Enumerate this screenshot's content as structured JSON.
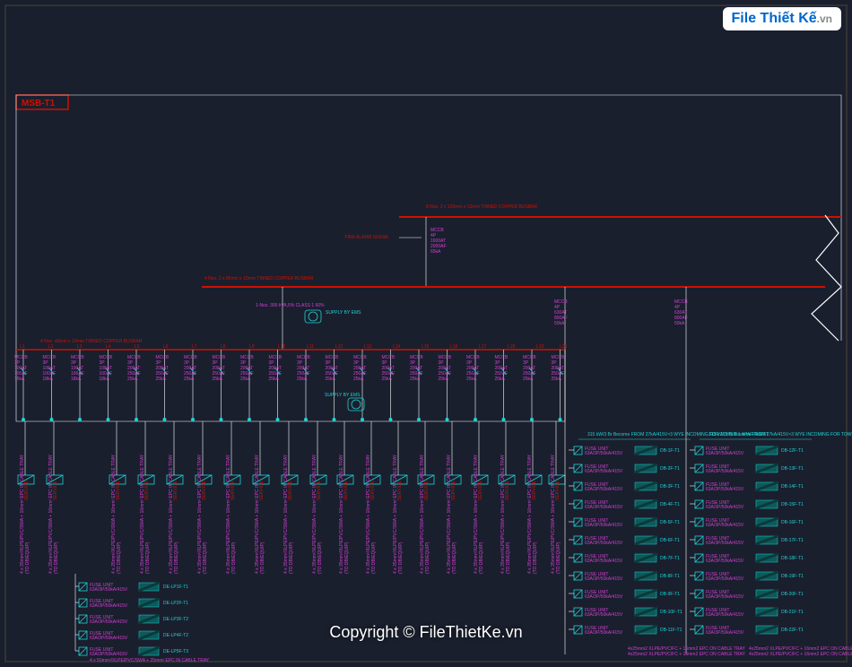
{
  "logo": {
    "brand": "File Thiết Kế",
    "suffix": ".vn"
  },
  "copyright": "Copyright © FileThietKe.vn",
  "panel": {
    "name": "MSB-T1"
  },
  "busbar_labels": {
    "top": "8 Nos. 2 x 100mm x 10mm\nTINNED COPPER BUSBAR",
    "mid": "4 Nos. 2 x 80mm x 10mm\nTINNED COPPER BUSBAR",
    "low": "4 Nos. 40mm x 10mm\nTINNED COPPER BUSBAR",
    "fire": "FIRE ALARM SIGNAL"
  },
  "device": {
    "sw": "SUPPLY BY EMS",
    "clamp": "1-Nos. 300 kVA,5%\nCLASS 1 60%"
  },
  "L_labels": [
    "L1",
    "L2",
    "L3",
    "L4",
    "L5",
    "L6",
    "L7",
    "L8",
    "L9",
    "L10",
    "L11",
    "L12",
    "L13",
    "L14",
    "L15",
    "L16",
    "L17",
    "L18",
    "L19",
    "L20"
  ],
  "vert_spec": {
    "line1": "MCCB",
    "line2": "3P",
    "line3": "100AT",
    "line4": "100AF",
    "line5": "18kA"
  },
  "vert_spec2": {
    "line1": "MCCB",
    "line2": "3P",
    "line3": "200AT",
    "line4": "250AF",
    "line5": "25kA"
  },
  "right_spec": {
    "line1": "MCCB",
    "line2": "4P",
    "line3": "630AT",
    "line4": "800AF",
    "line5": "50kA"
  },
  "cable_note": "4 x 35mm²/XLPE/PVC/SWA + 16mm² EPC IN CABLE TRAY",
  "cable_note2": "4 x 50mm²/XLPE/PVC/SWA + 25mm² EPC IN CABLE TRAY",
  "feeder_dest": [
    "DE-LP1F-T1",
    "DE-LP2F-T1",
    "DE-LP3F-T2",
    "DE-LP4F-T2",
    "DE-LP5F-T3"
  ],
  "feeder_note": "FUSE UNIT",
  "feeder_spec": "63A/3P/50kA/415V",
  "right_header": "315 kW/3 Br Become FROM 27kA/415V×3 WYE\nINCOMING FOR TOWER 1 APARTMENT",
  "db_list": [
    "DB-1F-T1",
    "DB-2F-T1",
    "DB-3F-T1",
    "DB-4F-T1",
    "DB-5F-T1",
    "DB-6F-T1",
    "DB-7F-T1",
    "DB-8F-T1",
    "DB-9F-T1",
    "DB-10F-T1",
    "DB-11F-T1"
  ],
  "db_list2": [
    "DB-12F-T1",
    "DB-13F-T1",
    "DB-14F-T1",
    "DB-15F-T1",
    "DB-16F-T1",
    "DB-17F-T1",
    "DB-18F-T1",
    "DB-19F-T1",
    "DB-20F-T1",
    "DB-21F-T1",
    "DB-22F-T1"
  ],
  "bottom_cable": "4x25mm2 XLPE/PVC/FC + 16mm2 EPC ON CABLE TRAY"
}
